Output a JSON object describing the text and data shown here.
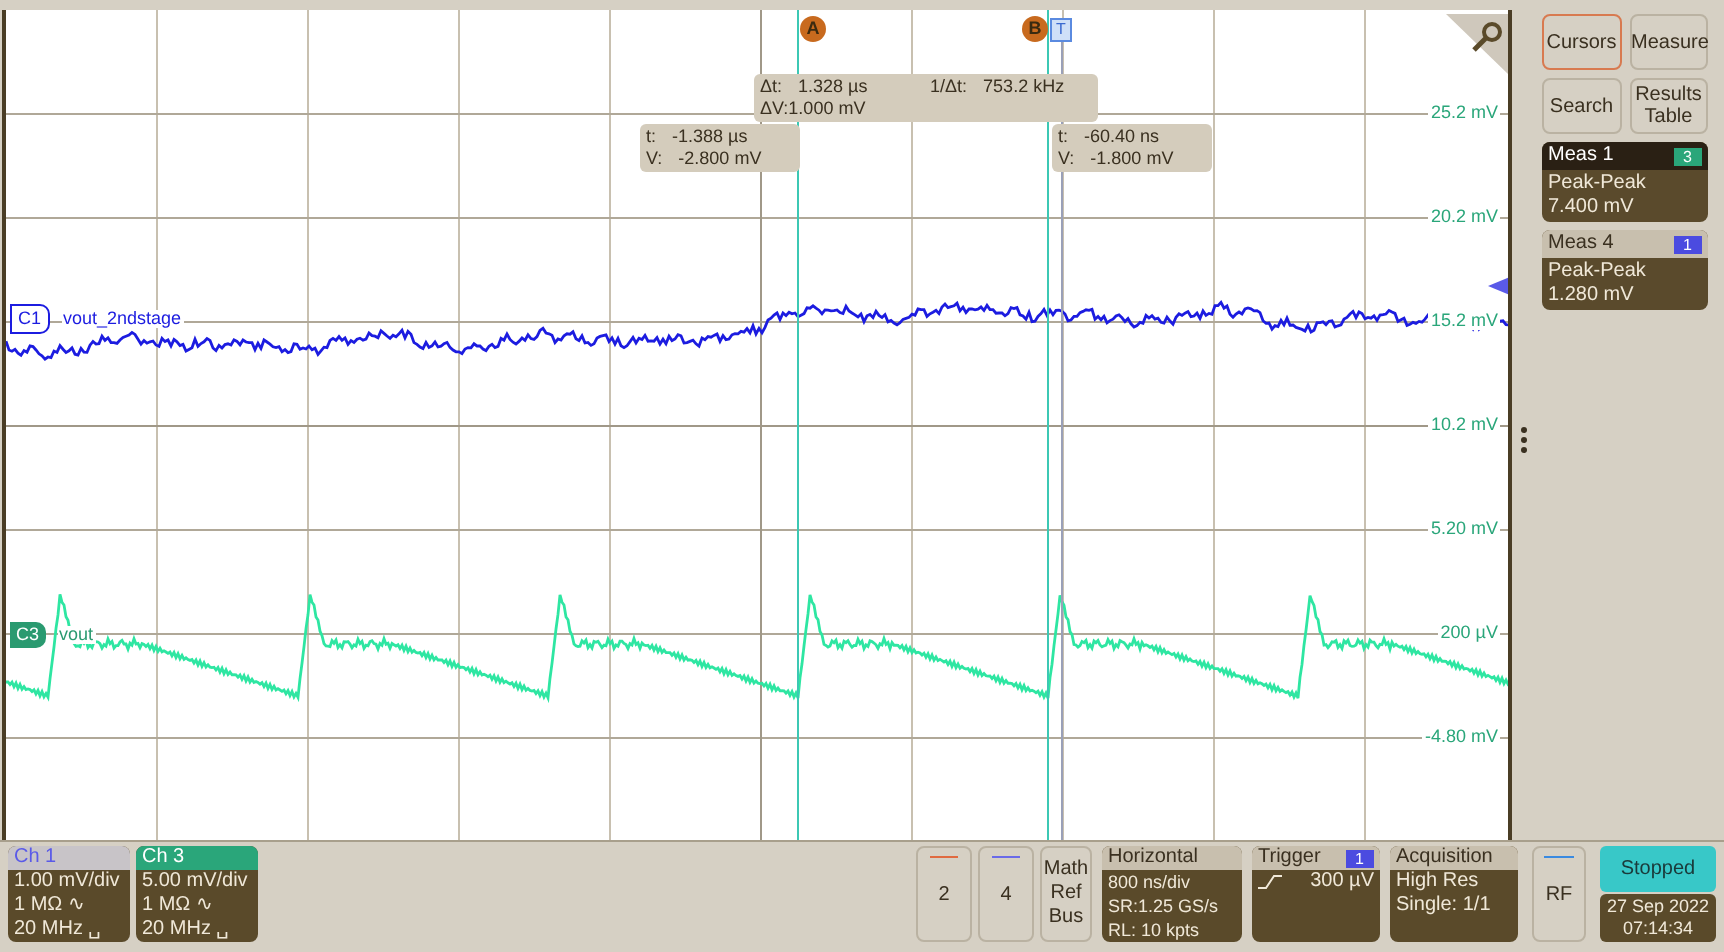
{
  "plot": {
    "scale_labels": [
      "25.2 mV",
      "20.2 mV",
      "15.2 mV",
      "10.2 mV",
      "5.20 mV",
      "200 µV",
      "-4.80 mV"
    ],
    "traces": [
      {
        "tag": "C1",
        "name": "vout_2ndstage",
        "kind": "outline",
        "color": "#1c1ce0"
      },
      {
        "tag": "C3",
        "name": "vout",
        "kind": "filled",
        "color": "#2ee6a2"
      }
    ],
    "cursors": [
      {
        "label": "A"
      },
      {
        "label": "B"
      }
    ],
    "trigger_marker": "T",
    "delta_readout": {
      "dt_label": "Δt:",
      "dt": "1.328 µs",
      "inv_label": "1/Δt:",
      "inv": "753.2 kHz",
      "dv": "ΔV:1.000 mV"
    },
    "cursor_readouts": [
      {
        "t_label": "t:",
        "t": "-1.388 µs",
        "v_label": "V:",
        "v": "-2.800 mV"
      },
      {
        "t_label": "t:",
        "t": "-60.40 ns",
        "v_label": "V:",
        "v": "-1.800 mV"
      }
    ]
  },
  "sidebar": {
    "buttons": [
      {
        "label": "Cursors",
        "selected": true
      },
      {
        "label": "Measure",
        "selected": false
      },
      {
        "label": "Search",
        "selected": false
      },
      {
        "label": "Results Table",
        "selected": false
      }
    ],
    "measurements": [
      {
        "title": "Meas 1",
        "source": "3",
        "color": "#2aa67a",
        "selected": true,
        "type": "Peak-Peak",
        "value": "7.400 mV"
      },
      {
        "title": "Meas 4",
        "source": "1",
        "color": "#4b4be0",
        "selected": false,
        "type": "Peak-Peak",
        "value": "1.280 mV"
      }
    ]
  },
  "bottom_bar": {
    "channels": [
      {
        "title": "Ch 1",
        "selected": false,
        "color": "#5a5ae8",
        "scale": "1.00 mV/div",
        "impedance": "1 MΩ ∿",
        "bandwidth": "20 MHz ␣"
      },
      {
        "title": "Ch 3",
        "selected": true,
        "color": "#2aa67a",
        "scale": "5.00 mV/div",
        "impedance": "1 MΩ ∿",
        "bandwidth": "20 MHz ␣"
      }
    ],
    "channel_buttons": [
      {
        "label": "2",
        "color": "#e06a40"
      },
      {
        "label": "4",
        "color": "#6a6ae8"
      }
    ],
    "math_button": "Math Ref Bus",
    "horizontal": {
      "title": "Horizontal",
      "lines": [
        "800 ns/div",
        "SR:1.25 GS/s",
        "RL: 10 kpts"
      ]
    },
    "trigger": {
      "title": "Trigger",
      "source": "1",
      "level": "300 µV"
    },
    "acquisition": {
      "title": "Acquisition",
      "lines": [
        "High Res",
        "Single: 1/1"
      ]
    },
    "rf_button": "RF",
    "run_state": "Stopped",
    "date": "27 Sep 2022",
    "time": "07:14:34"
  }
}
